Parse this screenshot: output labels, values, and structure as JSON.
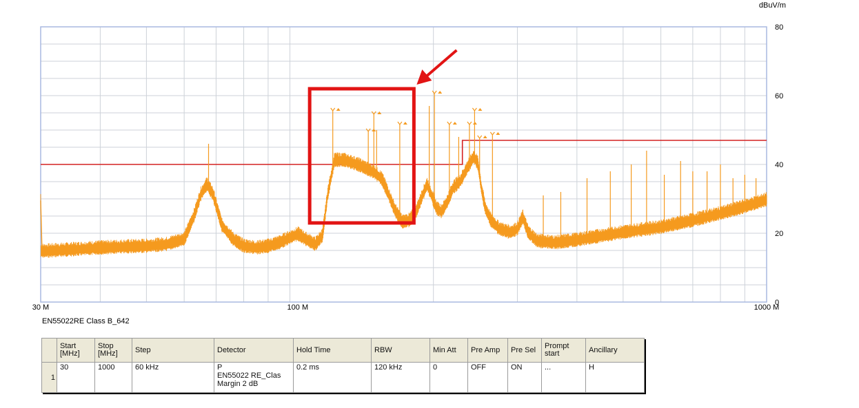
{
  "chart_data": {
    "type": "line",
    "y_unit": "dBuV/m",
    "xscale": "log",
    "xlim": [
      30,
      1000
    ],
    "ylim": [
      0,
      80
    ],
    "x_ticks": [
      {
        "value": 30,
        "label": "30 M"
      },
      {
        "value": 100,
        "label": "100 M"
      },
      {
        "value": 1000,
        "label": "1000 M"
      }
    ],
    "y_ticks": [
      {
        "value": 0,
        "label": "0"
      },
      {
        "value": 20,
        "label": "20"
      },
      {
        "value": 40,
        "label": "40"
      },
      {
        "value": 60,
        "label": "60"
      },
      {
        "value": 80,
        "label": "80"
      }
    ],
    "grid": true,
    "limit_line": {
      "color": "#d42020",
      "points": [
        [
          30,
          40
        ],
        [
          230,
          40
        ],
        [
          230,
          47
        ],
        [
          1000,
          47
        ]
      ]
    },
    "series": [
      {
        "color": "#f59a1e",
        "points": [
          [
            30,
            14.5
          ],
          [
            35,
            15
          ],
          [
            40,
            15.5
          ],
          [
            45,
            15.8
          ],
          [
            50,
            16
          ],
          [
            55,
            16.5
          ],
          [
            60,
            18
          ],
          [
            63,
            25
          ],
          [
            65,
            31
          ],
          [
            67,
            34
          ],
          [
            69,
            31
          ],
          [
            72,
            22
          ],
          [
            76,
            18
          ],
          [
            80,
            16
          ],
          [
            85,
            15.5
          ],
          [
            90,
            16
          ],
          [
            95,
            17
          ],
          [
            100,
            18.5
          ],
          [
            104,
            19.5
          ],
          [
            108,
            18
          ],
          [
            113,
            16.5
          ],
          [
            117,
            19
          ],
          [
            120,
            31
          ],
          [
            124,
            41
          ],
          [
            130,
            41
          ],
          [
            140,
            39.5
          ],
          [
            150,
            37.5
          ],
          [
            156,
            35.5
          ],
          [
            160,
            32
          ],
          [
            166,
            26.5
          ],
          [
            172,
            23
          ],
          [
            178,
            23.5
          ],
          [
            184,
            26
          ],
          [
            190,
            31
          ],
          [
            194,
            34
          ],
          [
            198,
            31
          ],
          [
            203,
            27
          ],
          [
            208,
            26
          ],
          [
            214,
            29
          ],
          [
            220,
            33
          ],
          [
            228,
            35
          ],
          [
            236,
            39
          ],
          [
            243,
            42
          ],
          [
            248,
            40
          ],
          [
            252,
            33
          ],
          [
            257,
            27
          ],
          [
            264,
            23.5
          ],
          [
            275,
            21
          ],
          [
            290,
            20
          ],
          [
            300,
            21
          ],
          [
            308,
            24.5
          ],
          [
            316,
            20
          ],
          [
            330,
            17.5
          ],
          [
            360,
            17
          ],
          [
            400,
            17.8
          ],
          [
            500,
            20
          ],
          [
            600,
            21.5
          ],
          [
            700,
            23.5
          ],
          [
            800,
            25.5
          ],
          [
            900,
            27.5
          ],
          [
            1000,
            29.5
          ]
        ]
      }
    ],
    "spikes": [
      [
        67.5,
        46
      ],
      [
        123,
        55
      ],
      [
        146,
        49
      ],
      [
        150,
        54
      ],
      [
        152,
        50
      ],
      [
        170,
        51
      ],
      [
        196,
        57
      ],
      [
        201,
        60
      ],
      [
        216,
        51
      ],
      [
        226,
        48
      ],
      [
        238,
        51
      ],
      [
        244,
        55
      ],
      [
        250,
        47
      ],
      [
        266,
        48
      ],
      [
        340,
        31
      ],
      [
        370,
        32
      ],
      [
        420,
        36
      ],
      [
        470,
        38
      ],
      [
        520,
        40
      ],
      [
        560,
        44
      ],
      [
        610,
        37
      ],
      [
        660,
        41
      ],
      [
        700,
        38
      ],
      [
        750,
        38
      ],
      [
        800,
        40
      ],
      [
        850,
        36
      ],
      [
        900,
        37
      ],
      [
        950,
        36
      ]
    ],
    "markers": [
      [
        123,
        55
      ],
      [
        146,
        49
      ],
      [
        150,
        54
      ],
      [
        170,
        51
      ],
      [
        201,
        60
      ],
      [
        216,
        51
      ],
      [
        238,
        51
      ],
      [
        244,
        55
      ],
      [
        250,
        47
      ],
      [
        266,
        48
      ]
    ],
    "highlight_box": {
      "x": [
        110,
        182
      ],
      "y": [
        23,
        62
      ],
      "color": "#e21414"
    },
    "arrow": {
      "color": "#e21414"
    }
  },
  "setup": {
    "title": "EN55022RE Class B_642",
    "headers": {
      "start": [
        "Start",
        "[MHz]"
      ],
      "stop": [
        "Stop",
        "[MHz]"
      ],
      "step": "Step",
      "detector": "Detector",
      "hold_time": "Hold Time",
      "rbw": "RBW",
      "min_att": "Min Att",
      "pre_amp": "Pre Amp",
      "pre_sel": "Pre Sel",
      "prompt": [
        "Prompt",
        "start"
      ],
      "ancillary": "Ancillary"
    },
    "row": {
      "index": "1",
      "start": "30",
      "stop": "1000",
      "step": "60 kHz",
      "detector": [
        "P",
        "EN55022 RE_Clas",
        "Margin 2 dB"
      ],
      "hold_time": "0.2 ms",
      "rbw": "120 kHz",
      "min_att": "0",
      "pre_amp": "OFF",
      "pre_sel": "ON",
      "prompt": "...",
      "ancillary": "H"
    }
  }
}
